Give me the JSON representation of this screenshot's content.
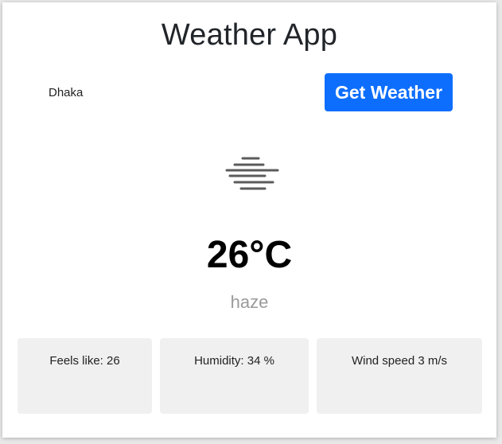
{
  "app": {
    "title": "Weather App"
  },
  "search": {
    "value": "Dhaka",
    "button_label": "Get Weather"
  },
  "current": {
    "icon": "haze-icon",
    "temperature": "26°C",
    "description": "haze"
  },
  "details": {
    "feels_like": "Feels like: 26",
    "humidity": "Humidity: 34 %",
    "wind_speed": "Wind speed 3 m/s"
  },
  "colors": {
    "button": "#0d6efd",
    "card_bg": "#ffffff",
    "stat_bg": "#f0f0f0",
    "description": "#9a9a9a"
  }
}
